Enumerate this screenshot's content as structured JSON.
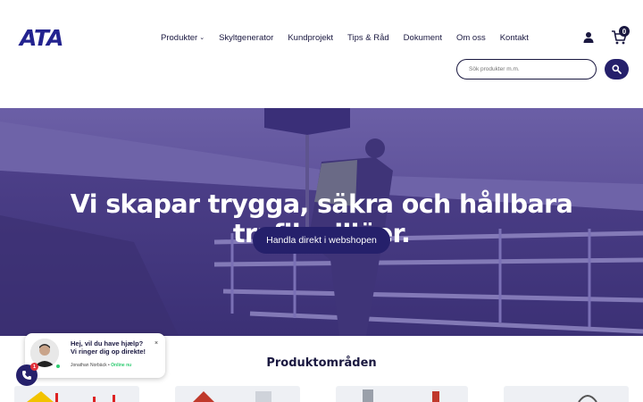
{
  "header": {
    "logo_text": "ATA",
    "nav": [
      {
        "label": "Produkter",
        "has_dropdown": true
      },
      {
        "label": "Skyltgenerator"
      },
      {
        "label": "Kundprojekt"
      },
      {
        "label": "Tips & Råd"
      },
      {
        "label": "Dokument"
      },
      {
        "label": "Om oss"
      },
      {
        "label": "Kontakt"
      }
    ],
    "cart_count": "0",
    "search_placeholder": "Sök produkter m.m.",
    "icons": [
      "user-icon",
      "cart-icon",
      "search-icon",
      "chevron-down-icon"
    ]
  },
  "hero": {
    "title": "Vi skapar trygga, säkra och hållbara trafikmiljöer.",
    "cta_label": "Handla direkt i webshopen"
  },
  "products": {
    "section_title": "Produktområden"
  },
  "chat": {
    "message": "Hej, vil du have hjælp? Vi ringer dig op direkte!",
    "agent_name": "Jonathan Norbäck",
    "status": "Online nu",
    "close_label": "×",
    "notification_count": "1"
  },
  "colors": {
    "brand_navy": "#25206b",
    "text_dark": "#1a1840",
    "hero_overlay": "#4d3f8a",
    "online": "#2ecc71",
    "badge_red": "#e0303a"
  }
}
